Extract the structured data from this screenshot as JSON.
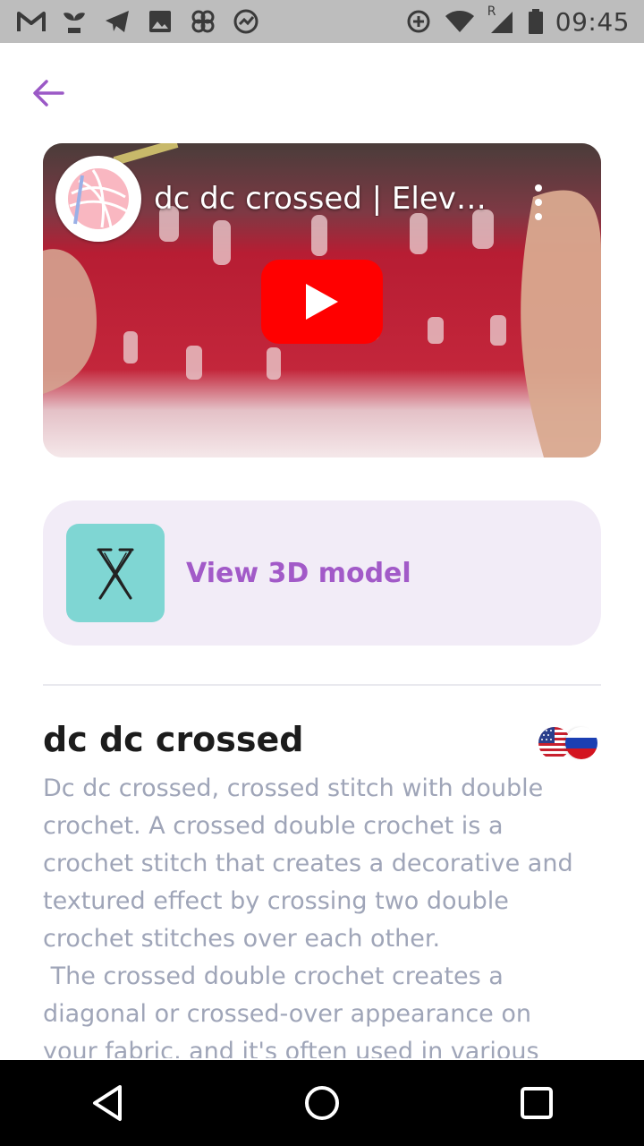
{
  "status_bar": {
    "time": "09:45",
    "network_label": "R",
    "left_icons": [
      "gmail-icon",
      "plant-icon",
      "telegram-icon",
      "image-icon",
      "pinwheel-icon",
      "chart-icon"
    ],
    "right_icons": [
      "data-saver-icon",
      "wifi-icon",
      "signal-icon",
      "battery-icon"
    ]
  },
  "header": {
    "back_icon": "arrow-left-icon",
    "accent_color": "#9b59c6"
  },
  "video": {
    "title": "dc dc crossed | Elevat…",
    "play_icon": "youtube-play-icon"
  },
  "model_card": {
    "label": "View 3D model",
    "icon": "crossed-stitch-icon"
  },
  "stitch": {
    "title": "dc dc crossed",
    "languages": [
      "us-flag-icon",
      "ru-flag-icon"
    ],
    "description": "Dc dc crossed, crossed stitch with double\ncrochet. A crossed double crochet is a\ncrochet stitch that creates a decorative and\ntextured effect by crossing two double\ncrochet stitches over each other.\n The crossed double crochet creates a\ndiagonal or crossed-over appearance on\nyour fabric, and it's often used in various"
  },
  "nav": {
    "back": "back-triangle-icon",
    "home": "home-circle-icon",
    "recents": "recents-square-icon"
  }
}
